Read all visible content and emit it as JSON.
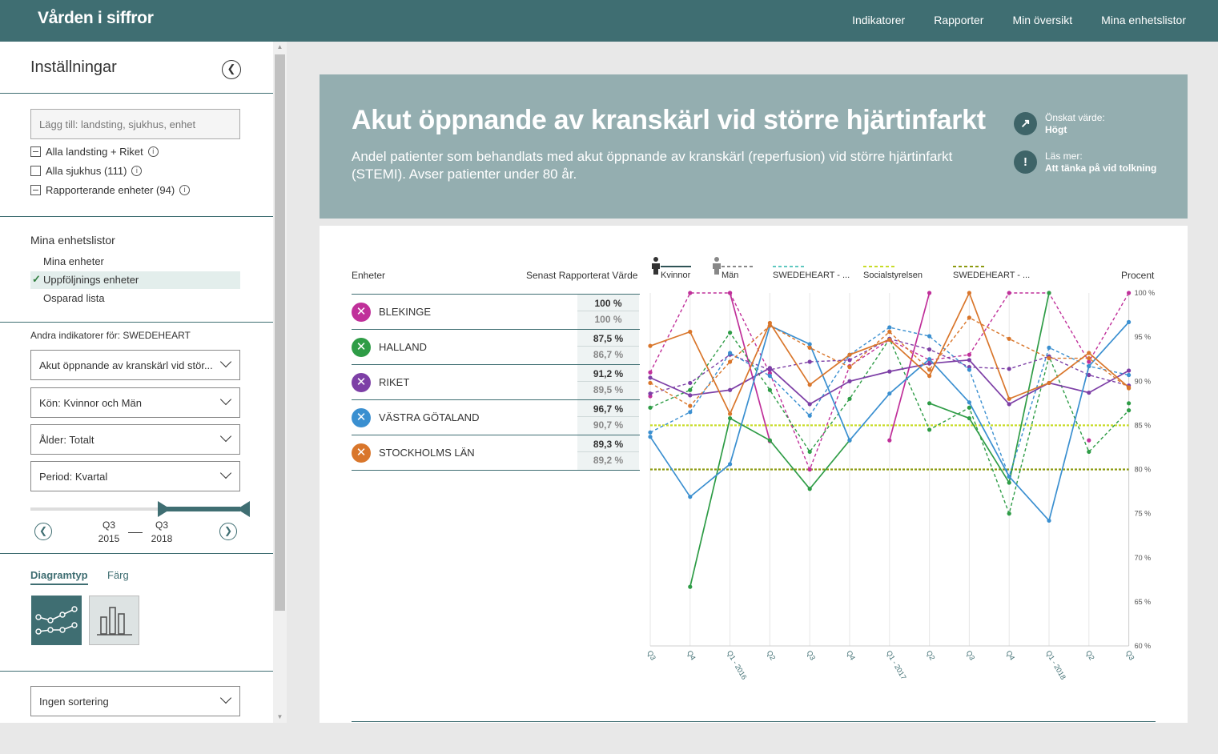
{
  "brand": "Vården i siffror",
  "topnav": [
    "Indikatorer",
    "Rapporter",
    "Min översikt",
    "Mina enhetslistor"
  ],
  "sidebar": {
    "title": "Inställningar",
    "search_placeholder": "Lägg till: landsting, sjukhus, enhet",
    "checks": [
      "Alla landsting + Riket",
      "Alla sjukhus (111)",
      "Rapporterande enheter (94)"
    ],
    "lists_title": "Mina enhetslistor",
    "lists": [
      "Mina enheter",
      "Uppföljnings enheter",
      "Osparad lista"
    ],
    "lists_selected_index": 1,
    "other_title": "Andra indikatorer för: SWEDEHEART",
    "indicator_dd": "Akut öppnande av kranskärl vid stör...",
    "gender_dd": {
      "label": "Kön:",
      "value": "Kvinnor och Män"
    },
    "age_dd": {
      "label": "Ålder:",
      "value": "Totalt"
    },
    "period_dd": {
      "label": "Period:",
      "value": "Kvartal"
    },
    "period_from": {
      "q": "Q3",
      "y": "2015"
    },
    "period_to": {
      "q": "Q3",
      "y": "2018"
    },
    "tabs": [
      "Diagramtyp",
      "Färg"
    ],
    "sort_dd": "Ingen sortering"
  },
  "header": {
    "title": "Akut öppnande av kranskärl vid större hjärtinfarkt",
    "desc": "Andel patienter som behandlats med akut öppnande av kranskärl (reperfusion) vid större hjärtinfarkt (STEMI). Avser patienter under 80 år.",
    "desired_label": "Önskat värde:",
    "desired_value": "Högt",
    "read_label": "Läs mer:",
    "read_value": "Att tänka på vid tolkning"
  },
  "table": {
    "col_units": "Enheter",
    "col_value": "Senast Rapporterat Värde",
    "rows": [
      {
        "name": "BLEKINGE",
        "color": "#c0309a",
        "v1": "100 %",
        "v2": "100 %"
      },
      {
        "name": "HALLAND",
        "color": "#2e9c46",
        "v1": "87,5 %",
        "v2": "86,7 %"
      },
      {
        "name": "RIKET",
        "color": "#7d3fa6",
        "v1": "91,2 %",
        "v2": "89,5 %"
      },
      {
        "name": "VÄSTRA GÖTALAND",
        "color": "#3a8fd0",
        "v1": "96,7 %",
        "v2": "90,7 %"
      },
      {
        "name": "STOCKHOLMS LÄN",
        "color": "#d9762b",
        "v1": "89,3 %",
        "v2": "89,2 %"
      }
    ]
  },
  "legend": {
    "women": "Kvinnor",
    "men": "Män",
    "swh1": "SWEDEHEART - ...",
    "social": "Socialstyrelsen",
    "swh2": "SWEDEHEART - ...",
    "unit": "Procent"
  },
  "chart_data": {
    "type": "line",
    "x": [
      "Q3",
      "Q4",
      "Q1 - 2016",
      "Q2",
      "Q3",
      "Q4",
      "Q1 - 2017",
      "Q2",
      "Q3",
      "Q4",
      "Q1 - 2018",
      "Q2",
      "Q3"
    ],
    "ylim": [
      60,
      100
    ],
    "yticks": [
      "100 %",
      "95 %",
      "90 %",
      "85 %",
      "80 %",
      "75 %",
      "70 %",
      "65 %",
      "60 %"
    ],
    "reference_lines": [
      {
        "name": "Socialstyrelsen",
        "value": 85,
        "color": "#c8dc28"
      },
      {
        "name": "SWEDEHEART - ...",
        "value": 80,
        "color": "#8c9a10"
      }
    ],
    "series": [
      {
        "name": "BLEKINGE",
        "color": "#c0309a",
        "women": [
          88.3,
          null,
          100,
          83.2,
          null,
          null,
          83.3,
          100,
          null,
          null,
          null,
          83.3,
          null
        ],
        "men": [
          91.0,
          100,
          100,
          90.9,
          80.0,
          91.7,
          94.7,
          92.4,
          93.0,
          100,
          100,
          92.2,
          100
        ]
      },
      {
        "name": "HALLAND",
        "color": "#2e9c46",
        "women": [
          null,
          66.7,
          85.8,
          83.3,
          77.8,
          83.3,
          null,
          87.5,
          85.8,
          78.5,
          100,
          null,
          87.5
        ],
        "men": [
          87.0,
          89.0,
          95.5,
          89.0,
          82.0,
          88.0,
          94.8,
          84.5,
          87.0,
          75.0,
          92.8,
          82.0,
          86.7
        ]
      },
      {
        "name": "RIKET",
        "color": "#7d3fa6",
        "women": [
          90.4,
          88.4,
          89.0,
          91.5,
          87.4,
          90.0,
          91.1,
          92.0,
          92.4,
          87.4,
          89.8,
          88.7,
          91.2
        ],
        "men": [
          88.6,
          89.8,
          93.0,
          91.3,
          92.2,
          92.4,
          94.8,
          93.6,
          91.6,
          91.4,
          92.8,
          90.7,
          89.5
        ]
      },
      {
        "name": "VÄSTRA GÖTALAND",
        "color": "#3a8fd0",
        "women": [
          83.7,
          76.9,
          80.6,
          96.3,
          94.2,
          83.3,
          88.6,
          92.5,
          87.6,
          79.2,
          74.2,
          91.7,
          96.7
        ],
        "men": [
          84.2,
          86.5,
          93.2,
          90.6,
          86.1,
          93.0,
          96.1,
          95.1,
          91.3,
          79.2,
          93.8,
          91.7,
          90.7
        ]
      },
      {
        "name": "STOCKHOLMS LÄN",
        "color": "#d9762b",
        "women": [
          94.0,
          95.6,
          86.3,
          96.6,
          89.6,
          93.0,
          94.7,
          90.6,
          100,
          88.0,
          89.8,
          93.2,
          89.3
        ],
        "men": [
          89.8,
          87.2,
          92.2,
          96.3,
          93.8,
          91.6,
          95.6,
          91.3,
          97.2,
          94.8,
          92.6,
          92.6,
          89.2
        ]
      }
    ]
  }
}
